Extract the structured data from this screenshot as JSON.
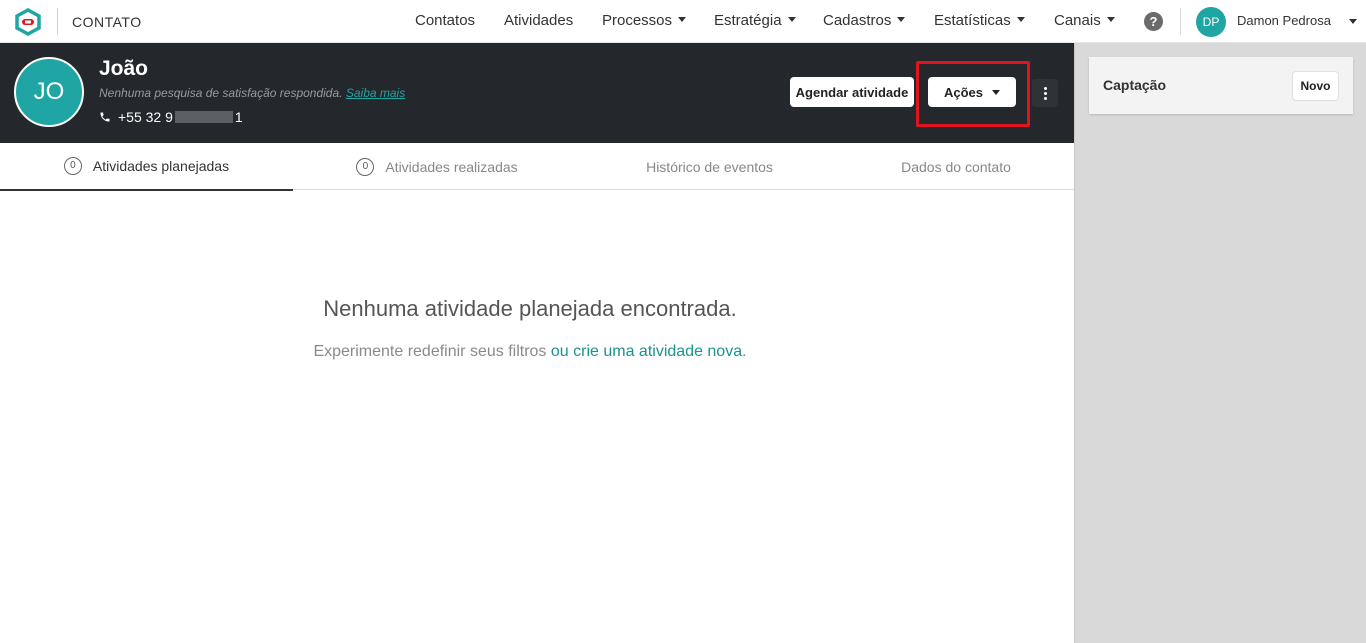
{
  "header": {
    "app_title": "CONTATO",
    "nav": [
      "Contatos",
      "Atividades",
      "Processos",
      "Estratégia",
      "Cadastros",
      "Estatísticas",
      "Canais"
    ],
    "help_label": "?",
    "user_initials": "DP",
    "user_name": "Damon Pedrosa"
  },
  "contact": {
    "initials": "JO",
    "name": "João",
    "survey_text": "Nenhuma pesquisa de satisfação respondida.",
    "survey_link": "Saiba mais",
    "phone_prefix": "+55 32 9",
    "phone_suffix": "1",
    "schedule_button": "Agendar atividade",
    "actions_button": "Ações"
  },
  "tabs": [
    {
      "count": "0",
      "label": "Atividades planejadas",
      "active": true
    },
    {
      "count": "0",
      "label": "Atividades realizadas",
      "active": false
    },
    {
      "label": "Histórico de eventos",
      "active": false
    },
    {
      "label": "Dados do contato",
      "active": false
    }
  ],
  "empty_state": {
    "title": "Nenhuma atividade planejada encontrada.",
    "subtitle": "Experimente redefinir seus filtros ",
    "link": "ou crie uma atividade nova",
    "end": "."
  },
  "sidebar": {
    "card_title": "Captação",
    "new_button": "Novo"
  },
  "colors": {
    "accent": "#1fa5a3",
    "header_bg": "#24272c",
    "highlight": "#e0141e"
  }
}
